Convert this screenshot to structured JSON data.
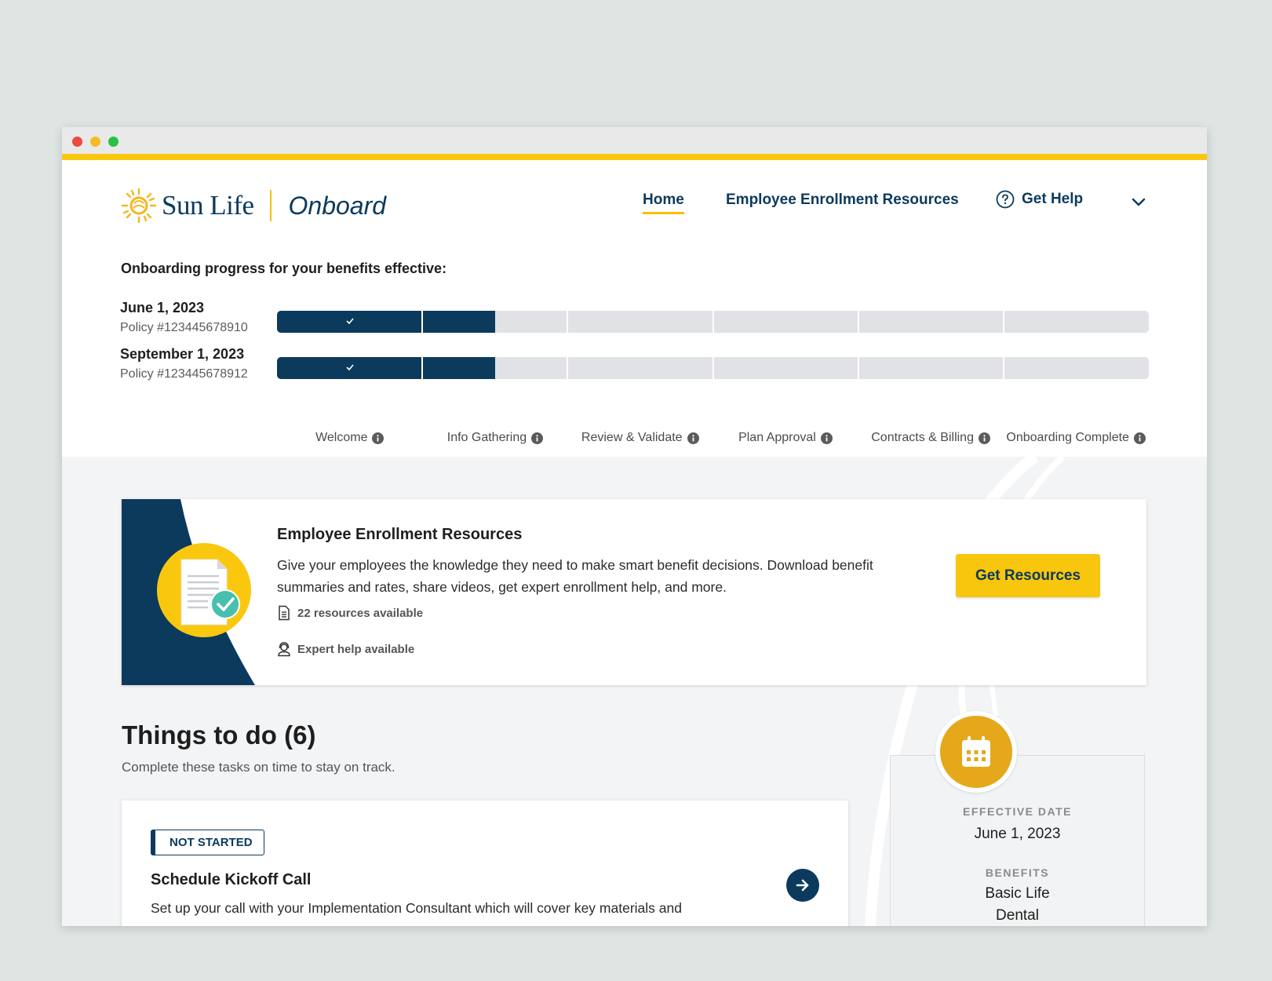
{
  "brand": {
    "name": "Sun Life",
    "product": "Onboard"
  },
  "nav": {
    "home": "Home",
    "resources": "Employee Enrollment Resources",
    "help": "Get Help"
  },
  "progress": {
    "heading": "Onboarding progress for your benefits effective:",
    "policies": [
      {
        "date": "June 1, 2023",
        "policy": "Policy #123445678910",
        "completed_stages": 1.5
      },
      {
        "date": "September 1, 2023",
        "policy": "Policy #123445678912",
        "completed_stages": 1.5
      }
    ],
    "stages": [
      "Welcome",
      "Info Gathering",
      "Review & Validate",
      "Plan Approval",
      "Contracts & Billing",
      "Onboarding Complete"
    ]
  },
  "resource_card": {
    "title": "Employee Enrollment Resources",
    "description": "Give your employees the knowledge they need to make smart benefit decisions. Download benefit summaries and rates, share videos, get expert enrollment help, and more.",
    "resources_count": "22 resources available",
    "expert_help": "Expert help available",
    "button": "Get Resources"
  },
  "todo": {
    "title": "Things to do (6)",
    "subtitle": "Complete these tasks on time to stay on track.",
    "task": {
      "status": "NOT STARTED",
      "title": "Schedule Kickoff Call",
      "description": "Set up your call with your Implementation Consultant which will cover key materials and"
    }
  },
  "effective": {
    "date_label": "EFFECTIVE DATE",
    "date": "June 1, 2023",
    "benefits_label": "BENEFITS",
    "benefits": [
      "Basic Life",
      "Dental"
    ]
  },
  "colors": {
    "navy": "#0b3a5d",
    "yellow": "#f9c80e",
    "gold": "#e4a81a",
    "track": "#e1e2e5",
    "teal": "#49bfae"
  }
}
